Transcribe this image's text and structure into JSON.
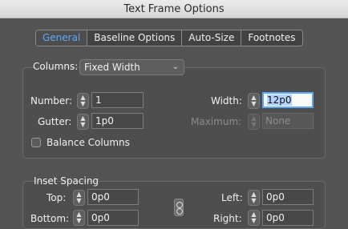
{
  "window": {
    "title": "Text Frame Options"
  },
  "tabs": [
    "General",
    "Baseline Options",
    "Auto-Size",
    "Footnotes"
  ],
  "columns": {
    "label": "Columns:",
    "type_value": "Fixed Width",
    "number_label": "Number:",
    "number_value": "1",
    "gutter_label": "Gutter:",
    "gutter_value": "1p0",
    "width_label": "Width:",
    "width_value": "12p0",
    "maximum_label": "Maximum:",
    "maximum_value": "None",
    "balance_label": "Balance Columns"
  },
  "inset": {
    "title": "Inset Spacing",
    "top_label": "Top:",
    "top_value": "0p0",
    "bottom_label": "Bottom:",
    "bottom_value": "0p0",
    "left_label": "Left:",
    "left_value": "0p0",
    "right_label": "Right:",
    "right_value": "0p0"
  },
  "icons": [
    "chevron-down-icon",
    "stepper-icon",
    "chain-link-icon"
  ]
}
